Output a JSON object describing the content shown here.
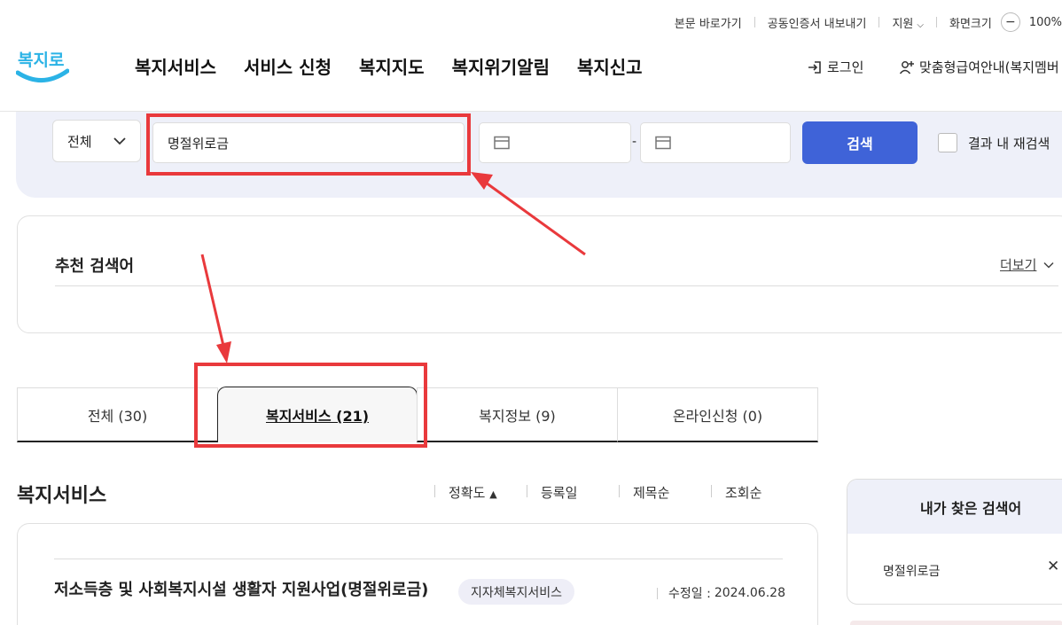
{
  "utility_bar": {
    "skip_link": "본문 바로가기",
    "cert_export": "공동인증서 내보내기",
    "support": "지원",
    "screen_size": "화면크기",
    "zoom_value": "100%"
  },
  "logo": {
    "text": "복지로"
  },
  "nav": {
    "items": [
      "복지서비스",
      "서비스 신청",
      "복지지도",
      "복지위기알림",
      "복지신고"
    ],
    "login": "로그인",
    "member_guide": "맞춤형급여안내(복지멤버"
  },
  "search": {
    "scope": "전체",
    "query": "명절위로금",
    "button": "검색",
    "research_label": "결과 내 재검색",
    "date_separator": "-"
  },
  "recommended": {
    "title": "추천 검색어",
    "more": "더보기"
  },
  "tabs": [
    {
      "label": "전체 (30)",
      "active": false
    },
    {
      "label": "복지서비스 (21)",
      "active": true
    },
    {
      "label": "복지정보 (9)",
      "active": false
    },
    {
      "label": "온라인신청 (0)",
      "active": false
    }
  ],
  "section": {
    "title": "복지서비스",
    "sorts": [
      "정확도",
      "등록일",
      "제목순",
      "조회순"
    ],
    "sort_indicator": "▲"
  },
  "results": [
    {
      "title": "저소득층 및 사회복지시설 생활자 지원사업(명절위로금)",
      "badge": "지자체복지서비스",
      "updated_label": "수정일 :",
      "updated_date": "2024.06.28"
    }
  ],
  "side_panel": {
    "title": "내가 찾은 검색어",
    "items": [
      "명절위로금"
    ],
    "close_glyph": "✕"
  },
  "annotation": {
    "color": "#e9393c"
  },
  "colors": {
    "primary": "#3f63d8",
    "band": "#eef0f9"
  }
}
